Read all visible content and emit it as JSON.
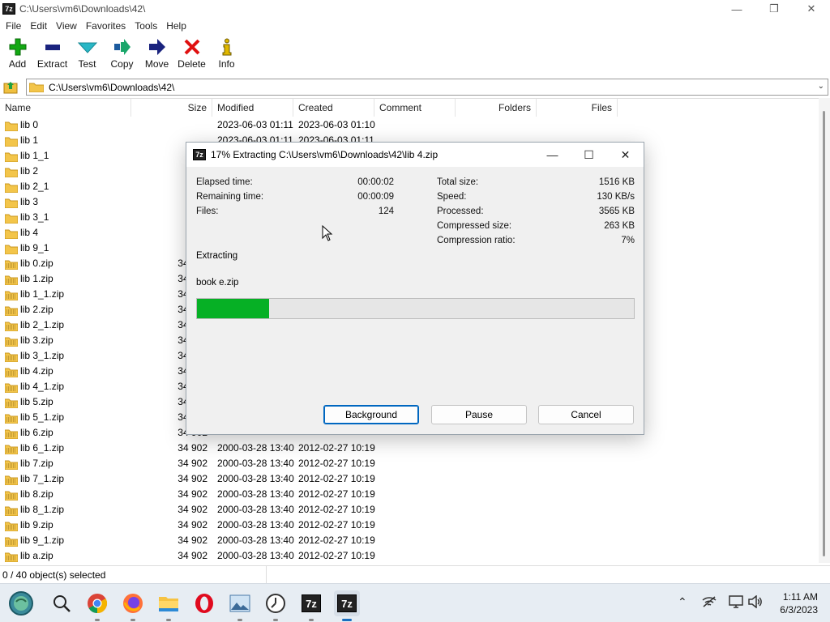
{
  "window": {
    "title": "C:\\Users\\vm6\\Downloads\\42\\",
    "logo_text": "7z"
  },
  "menu": [
    "File",
    "Edit",
    "View",
    "Favorites",
    "Tools",
    "Help"
  ],
  "toolbar": [
    {
      "label": "Add",
      "icon": "plus-icon",
      "color": "#10a010"
    },
    {
      "label": "Extract",
      "icon": "minus-icon",
      "color": "#1a237e"
    },
    {
      "label": "Test",
      "icon": "check-icon",
      "color": "#2ab7c6"
    },
    {
      "label": "Copy",
      "icon": "copy-arrow-icon",
      "color": "#1aa66a"
    },
    {
      "label": "Move",
      "icon": "move-arrow-icon",
      "color": "#1a237e"
    },
    {
      "label": "Delete",
      "icon": "delete-x-icon",
      "color": "#e01010"
    },
    {
      "label": "Info",
      "icon": "info-icon",
      "color": "#c9a400"
    }
  ],
  "address": {
    "path": "C:\\Users\\vm6\\Downloads\\42\\"
  },
  "columns": [
    "Name",
    "Size",
    "Modified",
    "Created",
    "Comment",
    "Folders",
    "Files"
  ],
  "files": [
    {
      "name": "lib 0",
      "type": "folder",
      "size": "",
      "modified": "2023-06-03 01:11",
      "created": "2023-06-03 01:10"
    },
    {
      "name": "lib 1",
      "type": "folder",
      "size": "",
      "modified": "2023-06-03 01:11",
      "created": "2023-06-03 01:11"
    },
    {
      "name": "lib 1_1",
      "type": "folder",
      "size": "",
      "modified": "",
      "created": ""
    },
    {
      "name": "lib 2",
      "type": "folder",
      "size": "",
      "modified": "",
      "created": ""
    },
    {
      "name": "lib 2_1",
      "type": "folder",
      "size": "",
      "modified": "",
      "created": ""
    },
    {
      "name": "lib 3",
      "type": "folder",
      "size": "",
      "modified": "",
      "created": ""
    },
    {
      "name": "lib 3_1",
      "type": "folder",
      "size": "",
      "modified": "",
      "created": ""
    },
    {
      "name": "lib 4",
      "type": "folder",
      "size": "",
      "modified": "",
      "created": ""
    },
    {
      "name": "lib 9_1",
      "type": "folder",
      "size": "",
      "modified": "",
      "created": ""
    },
    {
      "name": "lib 0.zip",
      "type": "zip",
      "size": "34 902",
      "modified": "",
      "created": ""
    },
    {
      "name": "lib 1.zip",
      "type": "zip",
      "size": "34 902",
      "modified": "",
      "created": ""
    },
    {
      "name": "lib 1_1.zip",
      "type": "zip",
      "size": "34 902",
      "modified": "",
      "created": ""
    },
    {
      "name": "lib 2.zip",
      "type": "zip",
      "size": "34 902",
      "modified": "",
      "created": ""
    },
    {
      "name": "lib 2_1.zip",
      "type": "zip",
      "size": "34 902",
      "modified": "",
      "created": ""
    },
    {
      "name": "lib 3.zip",
      "type": "zip",
      "size": "34 902",
      "modified": "",
      "created": ""
    },
    {
      "name": "lib 3_1.zip",
      "type": "zip",
      "size": "34 902",
      "modified": "",
      "created": ""
    },
    {
      "name": "lib 4.zip",
      "type": "zip",
      "size": "34 902",
      "modified": "",
      "created": ""
    },
    {
      "name": "lib 4_1.zip",
      "type": "zip",
      "size": "34 902",
      "modified": "",
      "created": ""
    },
    {
      "name": "lib 5.zip",
      "type": "zip",
      "size": "34 902",
      "modified": "",
      "created": ""
    },
    {
      "name": "lib 5_1.zip",
      "type": "zip",
      "size": "34 902",
      "modified": "",
      "created": ""
    },
    {
      "name": "lib 6.zip",
      "type": "zip",
      "size": "34 902",
      "modified": "",
      "created": ""
    },
    {
      "name": "lib 6_1.zip",
      "type": "zip",
      "size": "34 902",
      "modified": "2000-03-28 13:40",
      "created": "2012-02-27 10:19"
    },
    {
      "name": "lib 7.zip",
      "type": "zip",
      "size": "34 902",
      "modified": "2000-03-28 13:40",
      "created": "2012-02-27 10:19"
    },
    {
      "name": "lib 7_1.zip",
      "type": "zip",
      "size": "34 902",
      "modified": "2000-03-28 13:40",
      "created": "2012-02-27 10:19"
    },
    {
      "name": "lib 8.zip",
      "type": "zip",
      "size": "34 902",
      "modified": "2000-03-28 13:40",
      "created": "2012-02-27 10:19"
    },
    {
      "name": "lib 8_1.zip",
      "type": "zip",
      "size": "34 902",
      "modified": "2000-03-28 13:40",
      "created": "2012-02-27 10:19"
    },
    {
      "name": "lib 9.zip",
      "type": "zip",
      "size": "34 902",
      "modified": "2000-03-28 13:40",
      "created": "2012-02-27 10:19"
    },
    {
      "name": "lib 9_1.zip",
      "type": "zip",
      "size": "34 902",
      "modified": "2000-03-28 13:40",
      "created": "2012-02-27 10:19"
    },
    {
      "name": "lib a.zip",
      "type": "zip",
      "size": "34 902",
      "modified": "2000-03-28 13:40",
      "created": "2012-02-27 10:19"
    }
  ],
  "status": {
    "selection": "0 / 40 object(s) selected"
  },
  "dialog": {
    "title": "17% Extracting C:\\Users\\vm6\\Downloads\\42\\lib 4.zip",
    "elapsed_label": "Elapsed time:",
    "elapsed": "00:00:02",
    "remaining_label": "Remaining time:",
    "remaining": "00:00:09",
    "files_label": "Files:",
    "files": "124",
    "total_label": "Total size:",
    "total": "1516 KB",
    "speed_label": "Speed:",
    "speed": "130 KB/s",
    "processed_label": "Processed:",
    "processed": "3565 KB",
    "compressed_label": "Compressed size:",
    "compressed": "263 KB",
    "ratio_label": "Compression ratio:",
    "ratio": "7%",
    "status": "Extracting",
    "current_file": "book e.zip",
    "progress": 0.165,
    "buttons": {
      "background": "Background",
      "pause": "Pause",
      "cancel": "Cancel"
    },
    "accent": "#06b025"
  },
  "taskbar": {
    "time": "1:11 AM",
    "date": "6/3/2023",
    "apps": [
      "start-icon",
      "search-icon",
      "chrome-icon",
      "firefox-icon",
      "file-explorer-icon",
      "opera-icon",
      "image-viewer-icon",
      "clock-app-icon",
      "7zip-icon",
      "7zip-active-icon"
    ]
  }
}
